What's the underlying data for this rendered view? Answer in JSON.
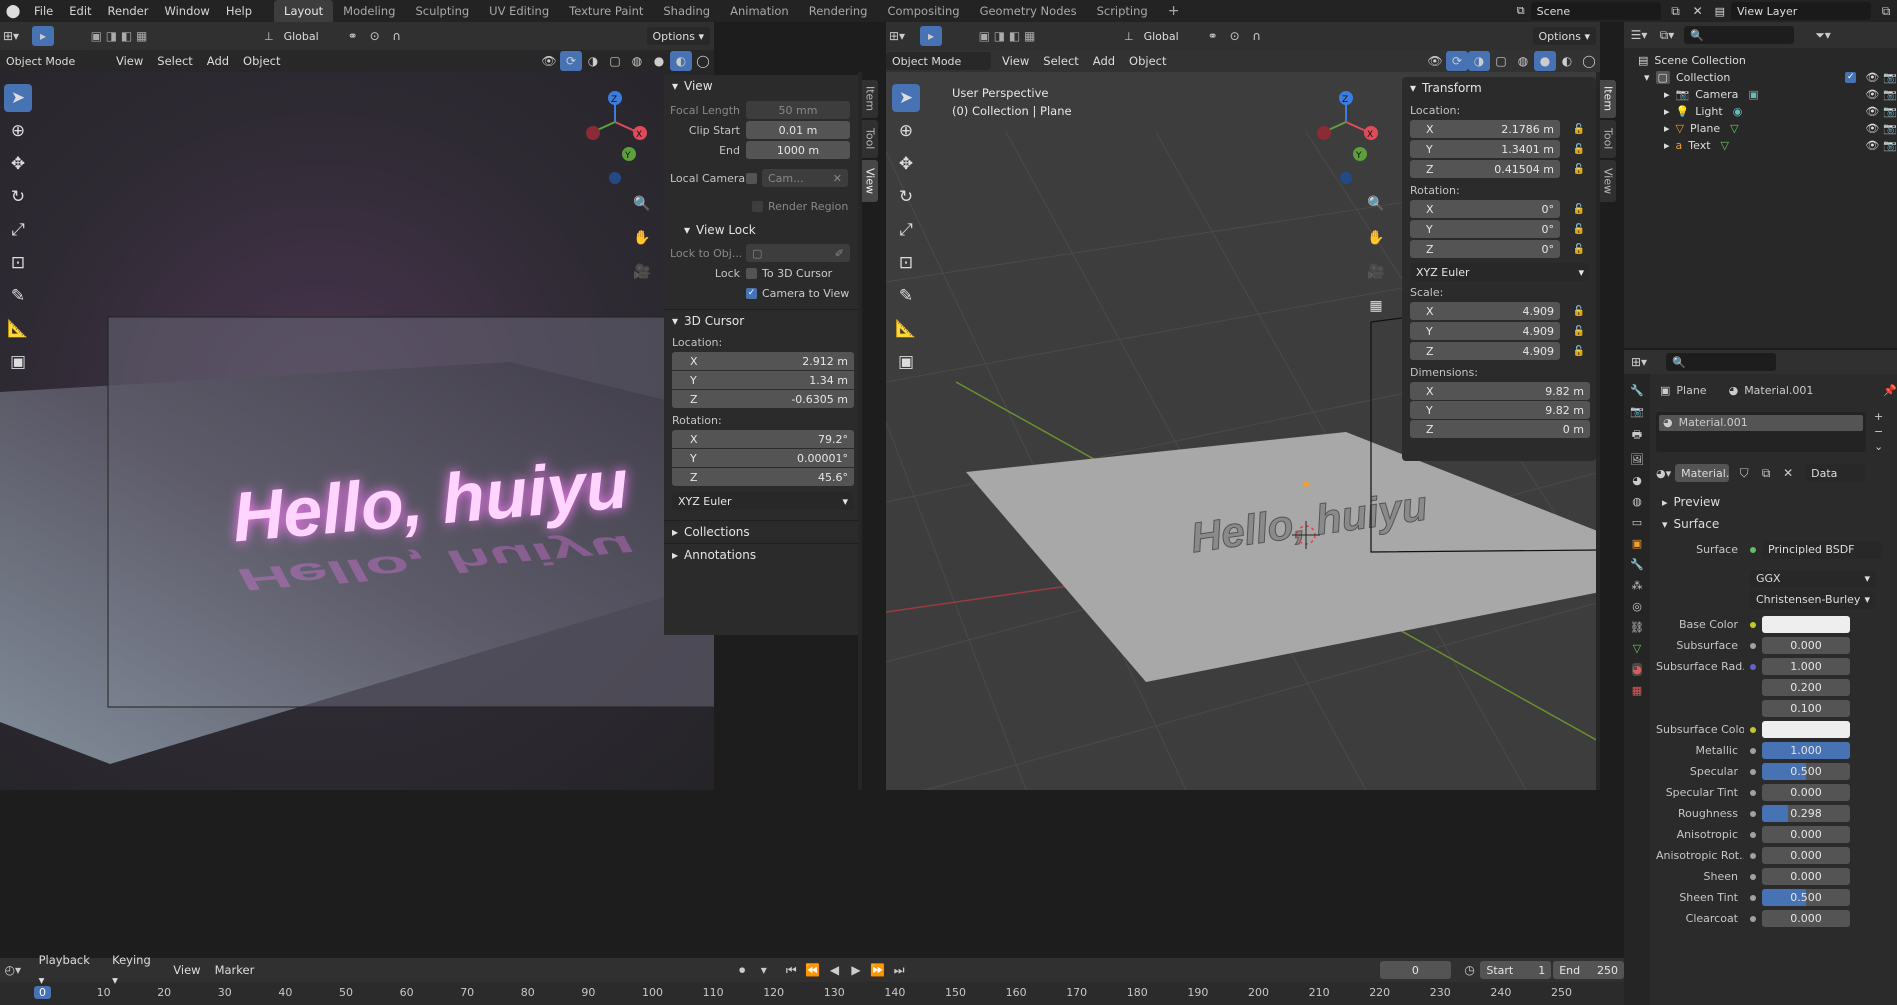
{
  "topbar": {
    "menus": [
      "File",
      "Edit",
      "Render",
      "Window",
      "Help"
    ],
    "workspaces": [
      "Layout",
      "Modeling",
      "Sculpting",
      "UV Editing",
      "Texture Paint",
      "Shading",
      "Animation",
      "Rendering",
      "Compositing",
      "Geometry Nodes",
      "Scripting"
    ],
    "active_workspace": "Layout",
    "add_tab": "+",
    "scene": "Scene",
    "view_layer": "View Layer"
  },
  "left_viewport": {
    "options": "Options",
    "transform_orientation": "Global",
    "mode": "Object Mode",
    "menus": [
      "View",
      "Select",
      "Add",
      "Object"
    ],
    "render_text": "Hello, huiyu",
    "tabs": [
      "Item",
      "Tool",
      "View"
    ],
    "active_tab": "View",
    "view_panel": {
      "title": "View",
      "focal_length_label": "Focal Length",
      "focal_length": "50 mm",
      "clip_start_label": "Clip Start",
      "clip_start": "0.01 m",
      "end_label": "End",
      "end": "1000 m",
      "local_camera_label": "Local Camera",
      "local_camera_value": "Cam...",
      "render_region_label": "Render Region",
      "view_lock_title": "View Lock",
      "lock_to_obj_label": "Lock to Obj...",
      "lock_label": "Lock",
      "to_3d_cursor_label": "To 3D Cursor",
      "camera_to_view_label": "Camera to View"
    },
    "cursor_panel": {
      "title": "3D Cursor",
      "location_label": "Location:",
      "loc": [
        {
          "axis": "X",
          "value": "2.912 m"
        },
        {
          "axis": "Y",
          "value": "1.34 m"
        },
        {
          "axis": "Z",
          "value": "-0.6305 m"
        }
      ],
      "rotation_label": "Rotation:",
      "rot": [
        {
          "axis": "X",
          "value": "79.2°"
        },
        {
          "axis": "Y",
          "value": "0.00001°"
        },
        {
          "axis": "Z",
          "value": "45.6°"
        }
      ],
      "rotation_mode": "XYZ Euler"
    },
    "collections_title": "Collections",
    "annotations_title": "Annotations"
  },
  "right_viewport": {
    "options": "Options",
    "transform_orientation": "Global",
    "mode": "Object Mode",
    "menus": [
      "View",
      "Select",
      "Add",
      "Object"
    ],
    "perspective_label": "User Perspective",
    "collection_label": "(0) Collection | Plane",
    "scene_text": "Hello, huiyu",
    "tabs": [
      "Item",
      "Tool",
      "View"
    ],
    "active_tab": "Item",
    "transform_panel": {
      "title": "Transform",
      "location_label": "Location:",
      "loc": [
        {
          "axis": "X",
          "value": "2.1786 m"
        },
        {
          "axis": "Y",
          "value": "1.3401 m"
        },
        {
          "axis": "Z",
          "value": "0.41504 m"
        }
      ],
      "rotation_label": "Rotation:",
      "rot": [
        {
          "axis": "X",
          "value": "0°"
        },
        {
          "axis": "Y",
          "value": "0°"
        },
        {
          "axis": "Z",
          "value": "0°"
        }
      ],
      "rotation_mode": "XYZ Euler",
      "scale_label": "Scale:",
      "scale": [
        {
          "axis": "X",
          "value": "4.909"
        },
        {
          "axis": "Y",
          "value": "4.909"
        },
        {
          "axis": "Z",
          "value": "4.909"
        }
      ],
      "dimensions_label": "Dimensions:",
      "dims": [
        {
          "axis": "X",
          "value": "9.82 m"
        },
        {
          "axis": "Y",
          "value": "9.82 m"
        },
        {
          "axis": "Z",
          "value": "0 m"
        }
      ]
    }
  },
  "outliner": {
    "root": "Scene Collection",
    "collection": "Collection",
    "items": [
      "Camera",
      "Light",
      "Plane",
      "Text"
    ]
  },
  "properties": {
    "object_name": "Plane",
    "material_name": "Material.001",
    "slot_name": "Material.001",
    "material_field": "Material...",
    "data_dropdown": "Data",
    "preview_label": "Preview",
    "surface_section": "Surface",
    "surface_label": "Surface",
    "surface_shader": "Principled BSDF",
    "distribution": "GGX",
    "subsurface_method": "Christensen-Burley",
    "rows": [
      {
        "label": "Base Color",
        "type": "color",
        "color": "#eeeeee"
      },
      {
        "label": "Subsurface",
        "value": "0.000",
        "fill": 0
      },
      {
        "label": "Subsurface Rad...",
        "value": "1.000",
        "fill": 0,
        "extra": [
          "0.200",
          "0.100"
        ]
      },
      {
        "label": "Subsurface Color",
        "type": "color",
        "color": "#eeeeee"
      },
      {
        "label": "Metallic",
        "value": "1.000",
        "fill": 1.0
      },
      {
        "label": "Specular",
        "value": "0.500",
        "fill": 0.5
      },
      {
        "label": "Specular Tint",
        "value": "0.000",
        "fill": 0
      },
      {
        "label": "Roughness",
        "value": "0.298",
        "fill": 0.298
      },
      {
        "label": "Anisotropic",
        "value": "0.000",
        "fill": 0
      },
      {
        "label": "Anisotropic Rot...",
        "value": "0.000",
        "fill": 0
      },
      {
        "label": "Sheen",
        "value": "0.000",
        "fill": 0
      },
      {
        "label": "Sheen Tint",
        "value": "0.500",
        "fill": 0.5
      },
      {
        "label": "Clearcoat",
        "value": "0.000",
        "fill": 0
      }
    ]
  },
  "timeline": {
    "menus": [
      "Playback",
      "Keying",
      "View",
      "Marker"
    ],
    "current_frame": "0",
    "start_label": "Start",
    "start": "1",
    "end_label": "End",
    "end": "250",
    "ticks": [
      "0",
      "10",
      "20",
      "30",
      "40",
      "50",
      "60",
      "70",
      "80",
      "90",
      "100",
      "110",
      "120",
      "130",
      "140",
      "150",
      "160",
      "170",
      "180",
      "190",
      "200",
      "210",
      "220",
      "230",
      "240",
      "250"
    ]
  },
  "colors": {
    "accent": "#4772b3",
    "glow": "#ff7dff",
    "header": "#303030",
    "panel": "#2b2b2b"
  }
}
